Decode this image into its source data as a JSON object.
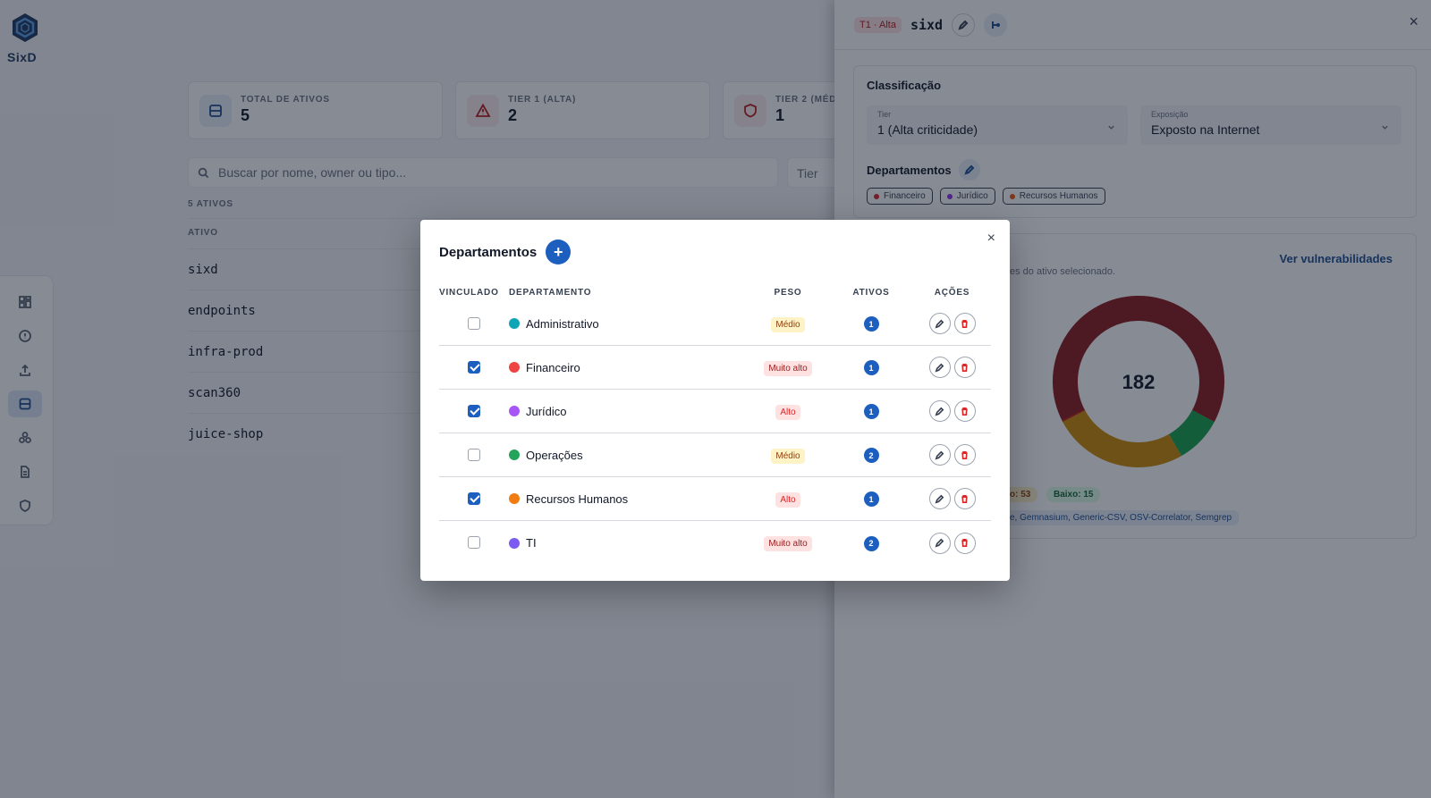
{
  "app": {
    "name": "SixD"
  },
  "stats": [
    {
      "label": "TOTAL DE ATIVOS",
      "value": "5",
      "icon": "server-icon",
      "color": "#1d4f91"
    },
    {
      "label": "TIER 1 (ALTA)",
      "value": "2",
      "icon": "warning-icon",
      "color": "#b91c1c"
    },
    {
      "label": "TIER 2 (MÉD",
      "value": "1",
      "icon": "shield-icon",
      "color": "#b91c1c"
    }
  ],
  "search": {
    "placeholder": "Buscar por nome, owner ou tipo..."
  },
  "tier_filter": {
    "label": "Tier"
  },
  "assets": {
    "count_label": "5 ATIVOS",
    "column": "ATIVO",
    "items": [
      "sixd",
      "endpoints",
      "infra-prod",
      "scan360",
      "juice-shop"
    ]
  },
  "panel": {
    "tier_badge": "T1 · Alta",
    "asset_name": "sixd",
    "close": "×",
    "classification": {
      "title": "Classificação",
      "tier_label": "Tier",
      "tier_value": "1 (Alta criticidade)",
      "exposure_label": "Exposição",
      "exposure_value": "Exposto na Internet",
      "departments_title": "Departamentos",
      "departments": [
        {
          "name": "Financeiro",
          "color": "#dc2626"
        },
        {
          "name": "Jurídico",
          "color": "#9333ea"
        },
        {
          "name": "Recursos Humanos",
          "color": "#ea580c"
        }
      ]
    },
    "vulns": {
      "link": "Ver vulnerabilidades",
      "subtitle": "es do ativo selecionado.",
      "total": "182",
      "medium_partial": "o: 53",
      "low": "Baixo: 15",
      "scanners": "e, Gemnasium, Generic-CSV, OSV-Correlator, Semgrep",
      "segment_colors": [
        "#8b1a1a",
        "#16a34a",
        "#ca8a04",
        "#c0141a"
      ]
    }
  },
  "modal": {
    "title": "Departamentos",
    "add": "+",
    "close": "×",
    "headers": {
      "linked": "VINCULADO",
      "department": "DEPARTAMENTO",
      "weight": "PESO",
      "assets": "ATIVOS",
      "actions": "AÇÕES"
    },
    "rows": [
      {
        "name": "Administrativo",
        "color": "#0ea5b7",
        "weight": "Médio",
        "weight_bg": "#fef3c7",
        "weight_fg": "#92400e",
        "assets": "1",
        "linked": false
      },
      {
        "name": "Financeiro",
        "color": "#ef4444",
        "weight": "Muito alto",
        "weight_bg": "#fee2e2",
        "weight_fg": "#991b1b",
        "assets": "1",
        "linked": true
      },
      {
        "name": "Jurídico",
        "color": "#a855f7",
        "weight": "Alto",
        "weight_bg": "#fee2e2",
        "weight_fg": "#dc2626",
        "assets": "1",
        "linked": true
      },
      {
        "name": "Operações",
        "color": "#22a55a",
        "weight": "Médio",
        "weight_bg": "#fef3c7",
        "weight_fg": "#92400e",
        "assets": "2",
        "linked": false
      },
      {
        "name": "Recursos Humanos",
        "color": "#f07c12",
        "weight": "Alto",
        "weight_bg": "#fee2e2",
        "weight_fg": "#dc2626",
        "assets": "1",
        "linked": true
      },
      {
        "name": "TI",
        "color": "#7c5cf0",
        "weight": "Muito alto",
        "weight_bg": "#fee2e2",
        "weight_fg": "#991b1b",
        "assets": "2",
        "linked": false
      }
    ]
  }
}
